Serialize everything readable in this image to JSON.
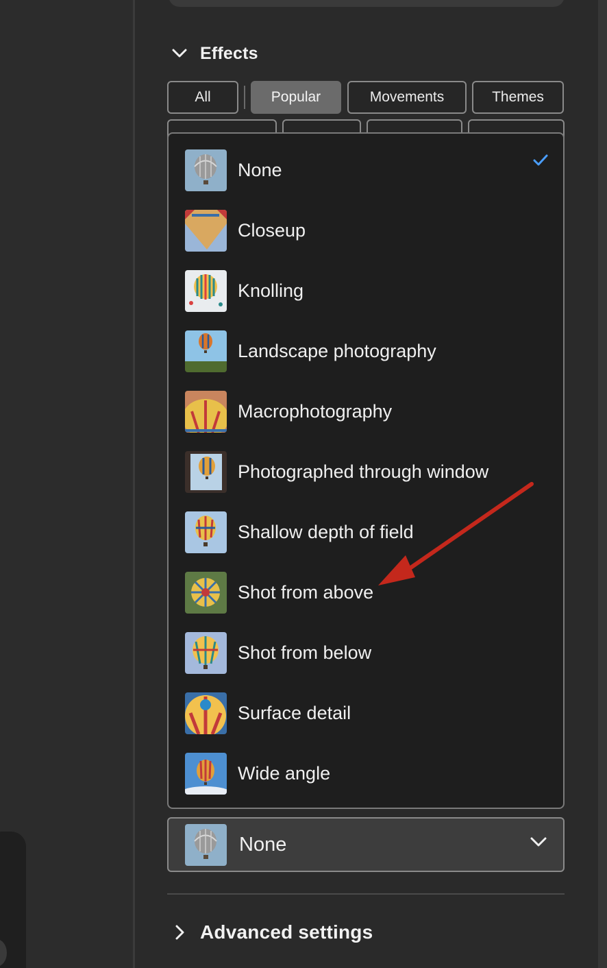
{
  "effects": {
    "title": "Effects",
    "tags_row1": [
      "All",
      "Popular",
      "Movements",
      "Themes"
    ],
    "active_tag": "Popular",
    "options": [
      {
        "label": "None",
        "selected": true,
        "icon": "balloon-gray-thumb"
      },
      {
        "label": "Closeup",
        "selected": false,
        "icon": "balloon-closeup-thumb"
      },
      {
        "label": "Knolling",
        "selected": false,
        "icon": "balloon-knolling-thumb"
      },
      {
        "label": "Landscape photography",
        "selected": false,
        "icon": "balloon-landscape-thumb"
      },
      {
        "label": "Macrophotography",
        "selected": false,
        "icon": "balloon-macro-thumb"
      },
      {
        "label": "Photographed through window",
        "selected": false,
        "icon": "balloon-window-thumb"
      },
      {
        "label": "Shallow depth of field",
        "selected": false,
        "icon": "balloon-shallow-thumb"
      },
      {
        "label": "Shot from above",
        "selected": false,
        "icon": "balloon-above-thumb"
      },
      {
        "label": "Shot from below",
        "selected": false,
        "icon": "balloon-below-thumb"
      },
      {
        "label": "Surface detail",
        "selected": false,
        "icon": "balloon-surface-thumb"
      },
      {
        "label": "Wide angle",
        "selected": false,
        "icon": "balloon-wide-thumb"
      }
    ],
    "selected_value": "None"
  },
  "advanced": {
    "title": "Advanced settings"
  },
  "colors": {
    "check": "#4a9eff",
    "annotation_arrow": "#c4281c"
  }
}
